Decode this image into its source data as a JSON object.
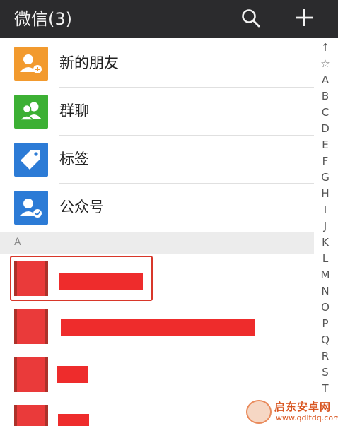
{
  "header": {
    "title": "微信(3)",
    "search_icon": "search-icon",
    "add_icon": "plus-icon"
  },
  "rows": [
    {
      "label": "新的朋友",
      "icon": "add-friend-icon",
      "color": "#f29a2e"
    },
    {
      "label": "群聊",
      "icon": "group-chat-icon",
      "color": "#3cb034"
    },
    {
      "label": "标签",
      "icon": "tag-icon",
      "color": "#2c7bd6"
    },
    {
      "label": "公众号",
      "icon": "official-account-icon",
      "color": "#2c7bd6"
    }
  ],
  "section": {
    "letter": "A"
  },
  "contacts": [
    {
      "name_redacted": true
    },
    {
      "name_redacted": true
    },
    {
      "name_redacted": true
    },
    {
      "name_redacted": true
    }
  ],
  "index_bar": [
    "↑",
    "☆",
    "A",
    "B",
    "C",
    "D",
    "E",
    "F",
    "G",
    "H",
    "I",
    "J",
    "K",
    "L",
    "M",
    "N",
    "O",
    "P",
    "Q",
    "R",
    "S",
    "T"
  ],
  "watermark": {
    "name": "启东安卓网",
    "url": "www.qdltdq.com"
  },
  "colors": {
    "header_bg": "#2b2b2d",
    "highlight": "#d8372a",
    "redaction": "#ee2c2c"
  }
}
